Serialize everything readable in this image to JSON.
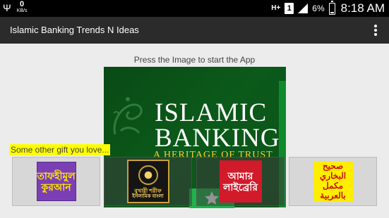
{
  "status_bar": {
    "usb_icon": "usb-icon",
    "speed_value": "0",
    "speed_unit": "KB/s",
    "network_type": "H+",
    "sim_slot": "1",
    "battery_percent": "6%",
    "time": "8:18 AM"
  },
  "action_bar": {
    "title": "Islamic Banking Trends N Ideas",
    "menu_icon": "overflow-menu-icon"
  },
  "content": {
    "hint": "Press the Image to start the App",
    "banner": {
      "line1": "ISLAMIC",
      "line2": "BANKING",
      "tagline": "A HERITAGE OF TRUST",
      "star_icon": "star-icon"
    },
    "gift_label": "Some other gift you love...",
    "apps": [
      {
        "name": "tafhimul-quran",
        "line1": "তাফহীমুল",
        "line2": "কুরআন"
      },
      {
        "name": "bukhari-sharif",
        "line1": "বুখারী শরীফ",
        "line2": "ইসলামিক বাংলা"
      },
      {
        "name": "amar-library",
        "line1": "আমার",
        "line2": "লাইব্রেরি"
      },
      {
        "name": "sahih-bukhari-arabic",
        "line1": "صحيح البخاري",
        "line2": "مكمل بالعربية"
      }
    ]
  },
  "colors": {
    "action_bar_bg": "#2b2b2b",
    "banner_green": "#0b5a1a",
    "star_button": "#1db34a",
    "gift_label_bg": "#ffff00"
  }
}
